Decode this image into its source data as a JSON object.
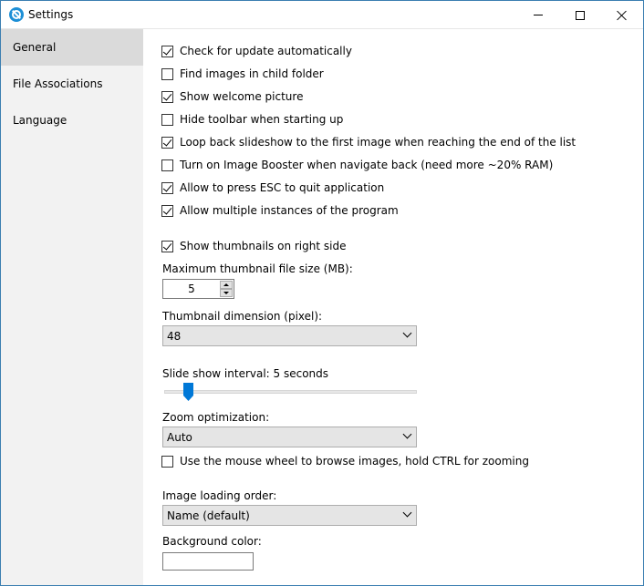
{
  "window": {
    "title": "Settings"
  },
  "sidebar": {
    "items": [
      {
        "label": "General",
        "active": true
      },
      {
        "label": "File Associations",
        "active": false
      },
      {
        "label": "Language",
        "active": false
      }
    ]
  },
  "general": {
    "checks": [
      {
        "label": "Check for update automatically",
        "checked": true
      },
      {
        "label": "Find images in child folder",
        "checked": false
      },
      {
        "label": "Show welcome picture",
        "checked": true
      },
      {
        "label": "Hide toolbar when starting up",
        "checked": false
      },
      {
        "label": "Loop back slideshow to the first image when reaching the end of the list",
        "checked": true
      },
      {
        "label": "Turn on Image Booster when navigate back (need more ~20% RAM)",
        "checked": false
      },
      {
        "label": "Allow to press ESC to quit application",
        "checked": true
      },
      {
        "label": "Allow multiple instances of the program",
        "checked": true
      }
    ],
    "thumbnails_check": {
      "label": "Show thumbnails on right side",
      "checked": true
    },
    "max_thumb_label": "Maximum thumbnail file size (MB):",
    "max_thumb_value": "5",
    "thumb_dim_label": "Thumbnail dimension (pixel):",
    "thumb_dim_value": "48",
    "slideshow_label": "Slide show interval: 5 seconds",
    "slideshow_value_fraction": 0.08,
    "zoom_label": "Zoom optimization:",
    "zoom_value": "Auto",
    "mouse_wheel_check": {
      "label": "Use the mouse wheel to browse images, hold CTRL for zooming",
      "checked": false
    },
    "load_order_label": "Image loading order:",
    "load_order_value": "Name (default)",
    "bg_color_label": "Background color:",
    "bg_color_value": "#ffffff"
  },
  "colors": {
    "accent": "#0078d7",
    "sidebar_bg": "#f2f2f2",
    "sidebar_active": "#dadada"
  }
}
